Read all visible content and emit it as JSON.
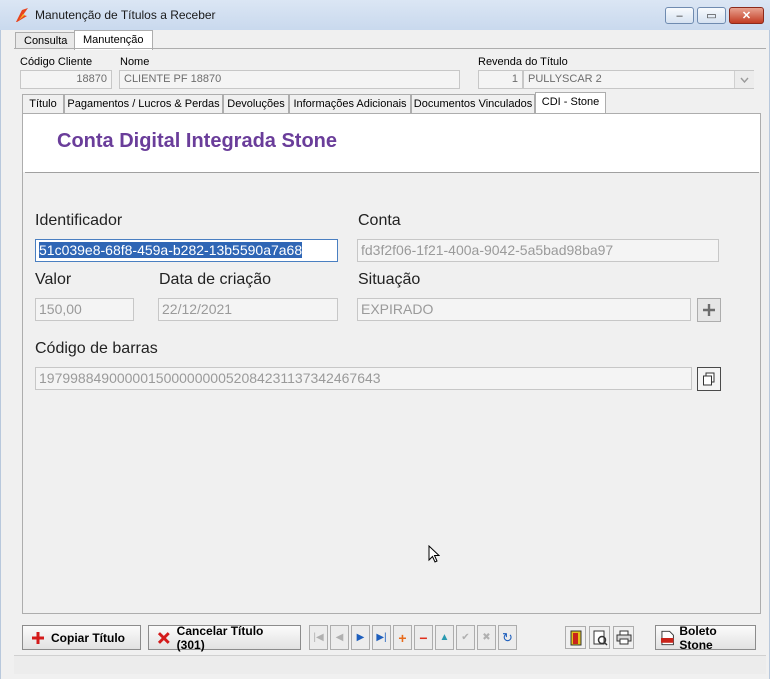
{
  "window": {
    "title": "Manutenção de Títulos a Receber",
    "min": "–",
    "max": "▭",
    "close": "✕"
  },
  "top_tabs": [
    "Consulta",
    "Manutenção"
  ],
  "header": {
    "codigo_label": "Código Cliente",
    "codigo_value": "18870",
    "nome_label": "Nome",
    "nome_value": "CLIENTE PF 18870",
    "revenda_label": "Revenda do Título",
    "revenda_num": "1",
    "revenda_value": "PULLYSCAR 2"
  },
  "sub_tabs": [
    "Título",
    "Pagamentos / Lucros & Perdas",
    "Devoluções",
    "Informações Adicionais",
    "Documentos Vinculados",
    "CDI - Stone"
  ],
  "panel": {
    "title": "Conta Digital Integrada Stone",
    "identificador_label": "Identificador",
    "identificador_value": "51c039e8-68f8-459a-b282-13b5590a7a68",
    "conta_label": "Conta",
    "conta_value": "fd3f2f06-1f21-400a-9042-5a5bad98ba97",
    "valor_label": "Valor",
    "valor_value": "150,00",
    "data_label": "Data de criação",
    "data_value": "22/12/2021",
    "situacao_label": "Situação",
    "situacao_value": "EXPIRADO",
    "barras_label": "Código de barras",
    "barras_value": "19799884900000150000000052084231137342467643"
  },
  "bottom": {
    "copiar": "Copiar Título",
    "cancelar": "Cancelar Título (301)",
    "boleto": "Boleto Stone"
  },
  "colors": {
    "accent": "#6a3d9a",
    "selection": "#2f66b5"
  }
}
